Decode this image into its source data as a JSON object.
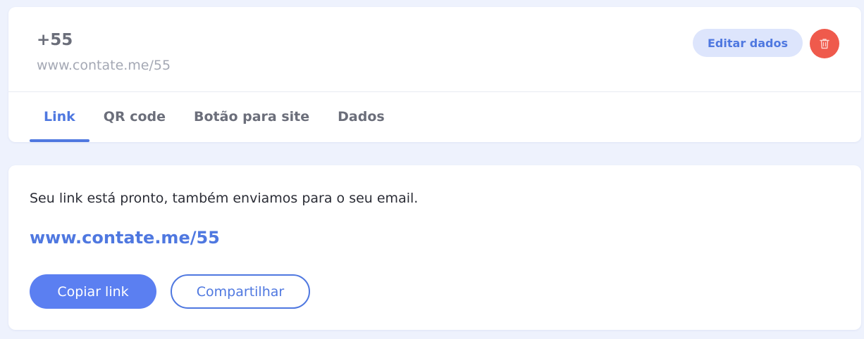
{
  "header": {
    "number": "+55",
    "subtitle": "www.contate.me/55",
    "edit_label": "Editar dados",
    "delete_icon": "trash-icon"
  },
  "tabs": [
    {
      "label": "Link",
      "active": true
    },
    {
      "label": "QR code",
      "active": false
    },
    {
      "label": "Botão para site",
      "active": false
    },
    {
      "label": "Dados",
      "active": false
    }
  ],
  "link_panel": {
    "message": "Seu link está pronto, também enviamos para o seu email.",
    "url": "www.contate.me/55",
    "copy_label": "Copiar link",
    "share_label": "Compartilhar"
  },
  "colors": {
    "accent": "#4f78e0",
    "primary_button": "#5b7ff1",
    "delete_button": "#ef5a4c",
    "edit_button_bg": "#dde5fc",
    "page_background": "#eef2fd"
  }
}
